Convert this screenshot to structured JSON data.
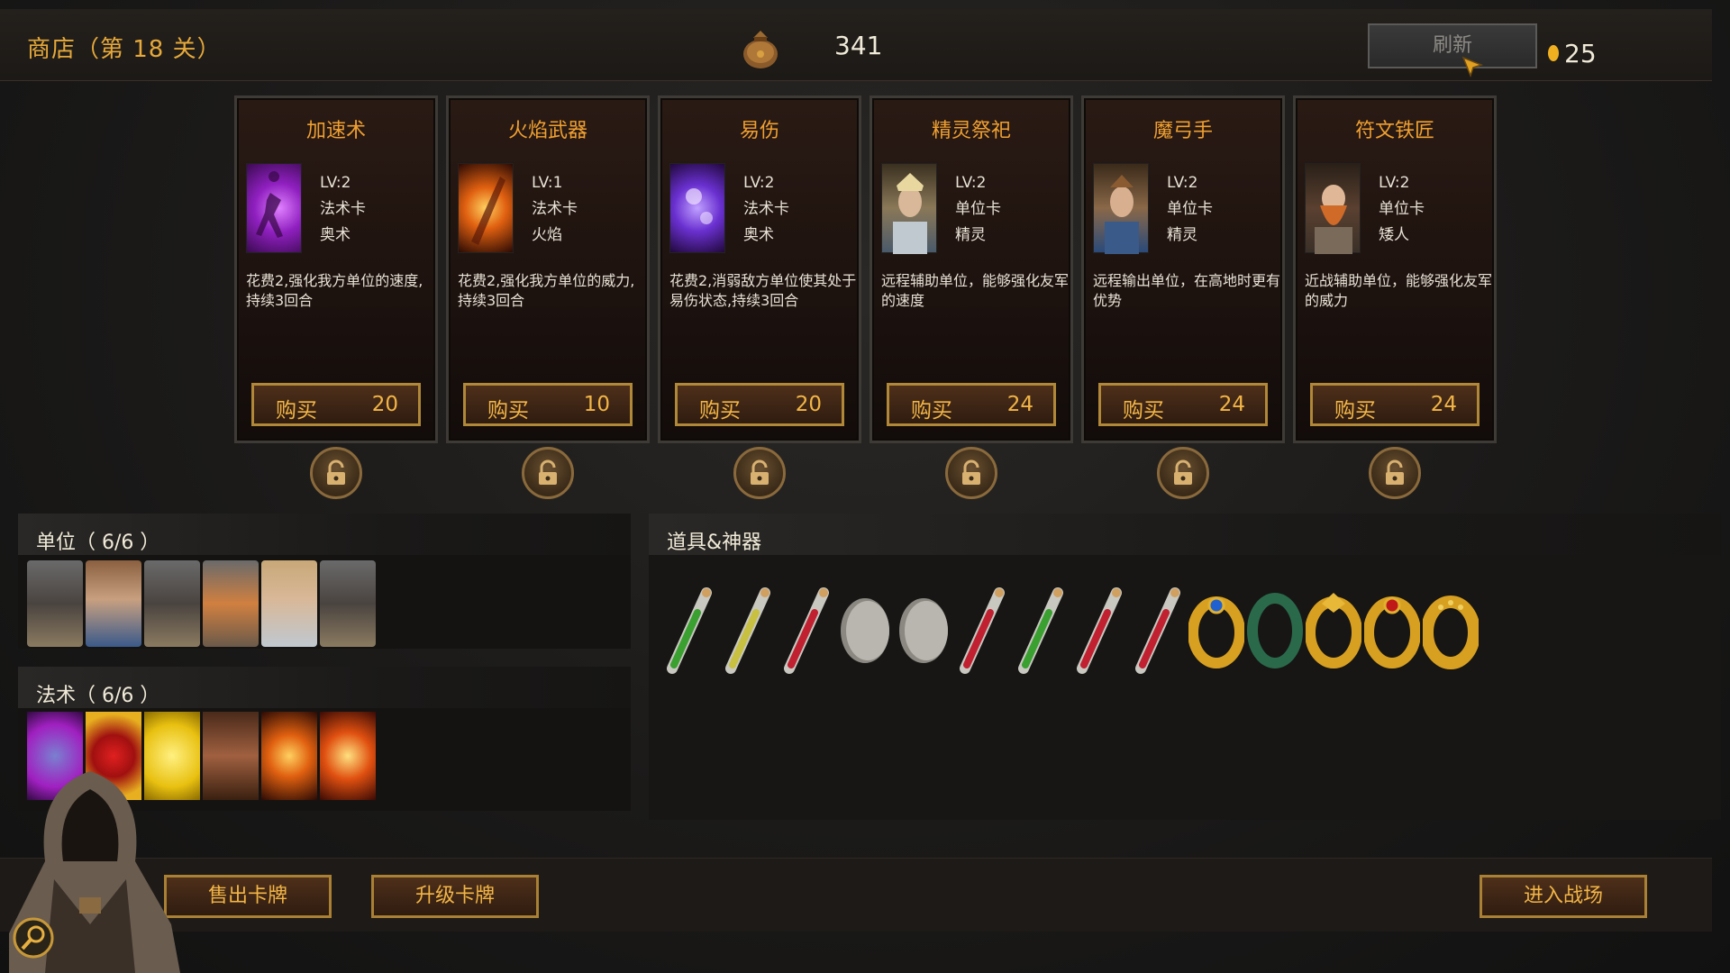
{
  "header": {
    "shop_title": "商店（第 18 关）",
    "gold": "341",
    "refresh_label": "刷新",
    "coin_count": "25"
  },
  "cards": [
    {
      "name": "加速术",
      "level": "LV:2",
      "kind": "法术卡",
      "school": "奥术",
      "desc": "花费2,强化我方单位的速度,持续3回合",
      "buy": "购买",
      "price": "20"
    },
    {
      "name": "火焰武器",
      "level": "LV:1",
      "kind": "法术卡",
      "school": "火焰",
      "desc": "花费2,强化我方单位的威力,持续3回合",
      "buy": "购买",
      "price": "10"
    },
    {
      "name": "易伤",
      "level": "LV:2",
      "kind": "法术卡",
      "school": "奥术",
      "desc": "花费2,消弱敌方单位使其处于易伤状态,持续3回合",
      "buy": "购买",
      "price": "20"
    },
    {
      "name": "精灵祭祀",
      "level": "LV:2",
      "kind": "单位卡",
      "school": "精灵",
      "desc": "远程辅助单位，能够强化友军的速度",
      "buy": "购买",
      "price": "24"
    },
    {
      "name": "魔弓手",
      "level": "LV:2",
      "kind": "单位卡",
      "school": "精灵",
      "desc": "远程输出单位，在高地时更有优势",
      "buy": "购买",
      "price": "24"
    },
    {
      "name": "符文铁匠",
      "level": "LV:2",
      "kind": "单位卡",
      "school": "矮人",
      "desc": "近战辅助单位，能够强化友军的威力",
      "buy": "购买",
      "price": "24"
    }
  ],
  "units_panel": {
    "title": "单位（ 6/6 ）"
  },
  "spells_panel": {
    "title": "法术（ 6/6 ）"
  },
  "items_panel": {
    "title": "道具&神器"
  },
  "bottom": {
    "sell_label": "售出卡牌",
    "upgrade_label": "升级卡牌",
    "battle_label": "进入战场"
  },
  "colors": {
    "accent": "#f0a030",
    "gold_border": "#b08838"
  }
}
